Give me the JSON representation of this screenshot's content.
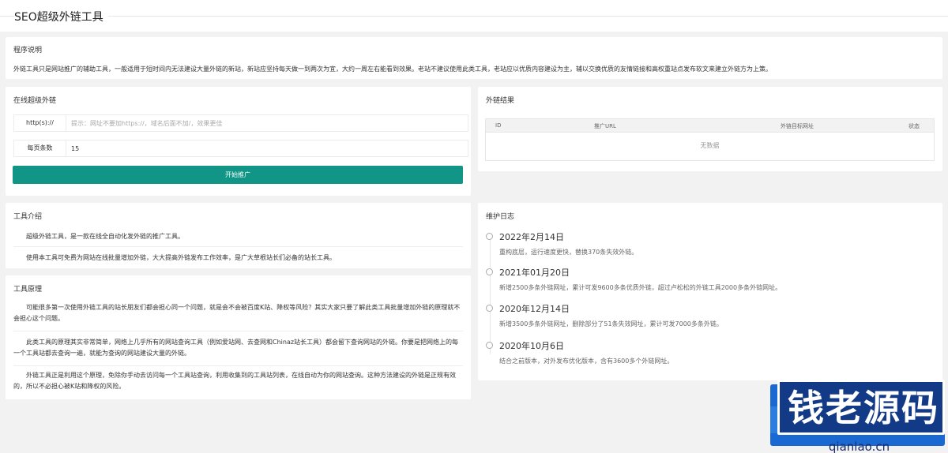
{
  "header": {
    "title": "SEO超级外链工具"
  },
  "description": {
    "heading": "程序说明",
    "text": "外链工具只是网站推广的辅助工具，一般适用于短时间内无法建设大量外链的新站，新站应坚持每天做一到两次为宜，大约一周左右能看到效果。老站不建议使用此类工具，老站应以优质内容建设为主，辅以交换优质的友情链接和高权重站点发布软文来建立外链方为上策。"
  },
  "online": {
    "heading": "在线超级外链",
    "url_label": "http(s)://",
    "url_placeholder": "提示：网址不要加https://，域名后面不加/，效果更佳",
    "url_value": "",
    "per_page_label": "每页条数",
    "per_page_value": "15",
    "start_button": "开始推广"
  },
  "results": {
    "heading": "外链结果",
    "columns": [
      "ID",
      "推广URL",
      "外链目标网址",
      "状态"
    ],
    "empty_text": "无数据"
  },
  "intro": {
    "heading": "工具介绍",
    "p1": "超级外链工具，是一款在线全自动化发外链的推广工具。",
    "p2": "使用本工具可免费为网站在线批量增加外链，大大提高外链发布工作效率，是广大草根站长们必备的站长工具。"
  },
  "principle": {
    "heading": "工具原理",
    "p1": "可能很多第一次使用外链工具的站长朋友们都会担心同一个问题，就是会不会被百度K站、降权等风险？其实大家只要了解此类工具批量增加外链的原理就不会担心这个问题。",
    "p2": "此类工具的原理其实非常简单，网络上几乎所有的网站查询工具（例如爱站网、去查网和Chinaz站长工具）都会留下查询网站的外链。你要是把网络上的每一个工具站都去查询一遍，就能为查询的网站建设大量的外链。",
    "p3": "外链工具正是利用这个原理，免除你手动去访问每一个工具站查询，利用收集到的工具站列表，在线自动为你的网站查询。这种方法建设的外链是正规有效的，所以不必担心被K站和降权的风险。"
  },
  "log": {
    "heading": "维护日志",
    "items": [
      {
        "date": "2022年2月14日",
        "text": "重构底层，运行速度更快，替换370条失效外链。"
      },
      {
        "date": "2021年01月20日",
        "text": "新增2500多条外链网址，累计可发9600多条优质外链，超过卢松松的外链工具2000多条外链网址。"
      },
      {
        "date": "2020年12月14日",
        "text": "新增3500多条外链网址，删除部分了51条失效网址，累计可发7000多条外链。"
      },
      {
        "date": "2020年10月6日",
        "text": "结合之前版本，对外发布优化版本，含有3600多个外链网址。"
      }
    ]
  },
  "watermark": {
    "name": "钱老源码",
    "url": "qianlao.cn"
  }
}
